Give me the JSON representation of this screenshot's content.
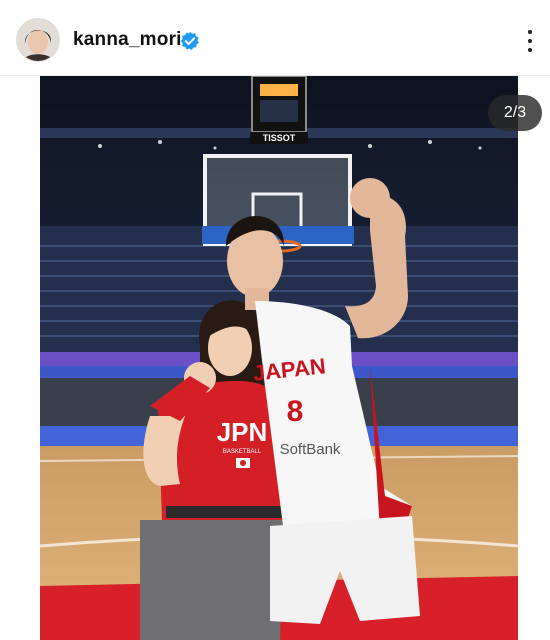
{
  "post": {
    "username": "kanna_mori",
    "verified": true,
    "more_icon": "more-vertical-icon"
  },
  "carousel": {
    "counter": "2/3",
    "current": 2,
    "total": 3
  },
  "photo": {
    "scoreboard_brand": "TISSOT",
    "woman_shirt_text": "JPN",
    "woman_shirt_subtext": "BASKETBALL",
    "jersey_team": "JAPAN",
    "jersey_number": "8",
    "jersey_sponsor": "SoftBank"
  },
  "colors": {
    "verified_blue": "#1d9bf0",
    "court_red": "#d8202a",
    "jersey_red": "#c8141e"
  }
}
